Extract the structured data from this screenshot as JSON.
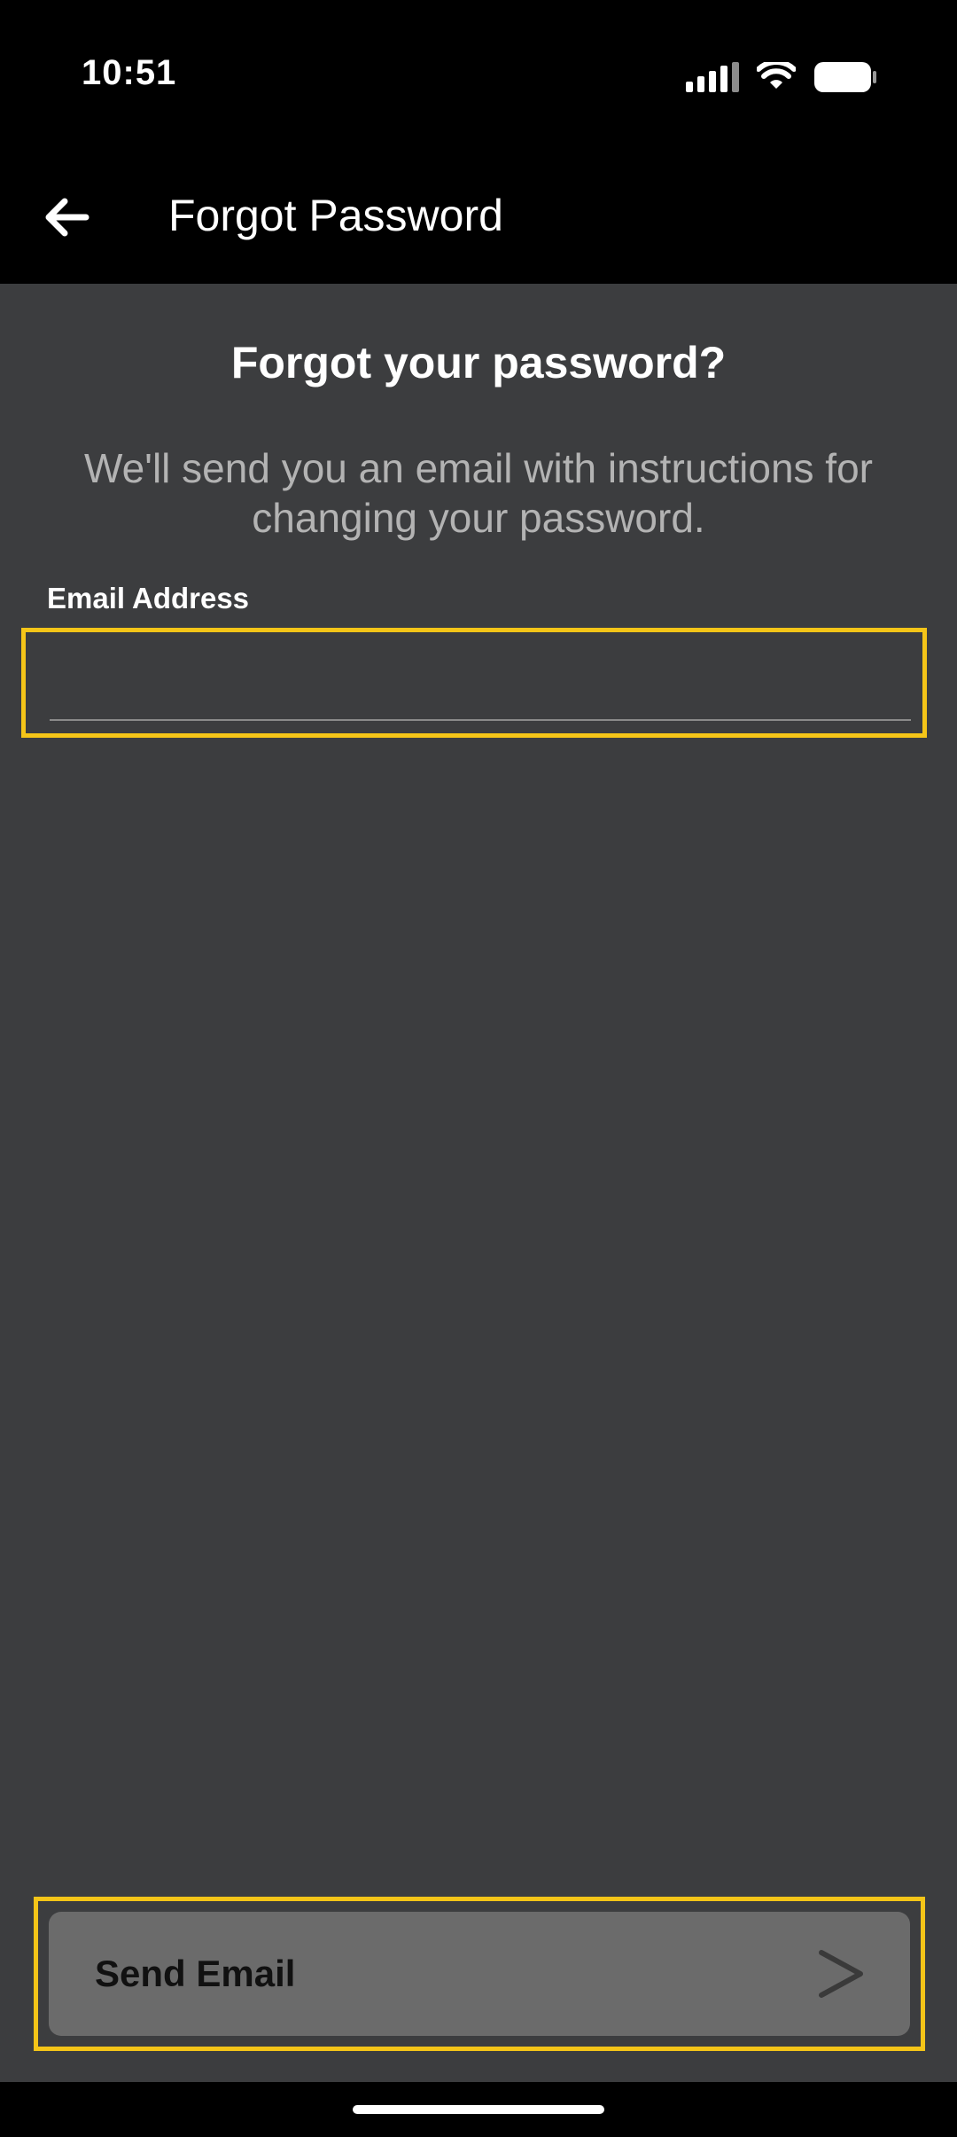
{
  "status_bar": {
    "time": "10:51",
    "icons": [
      "signal-icon",
      "wifi-icon",
      "battery-icon"
    ]
  },
  "app_bar": {
    "back_icon": "arrow-left-icon",
    "title": "Forgot Password"
  },
  "main": {
    "heading": "Forgot your password?",
    "description": "We'll send you an email with instructions for changing your password.",
    "email_field": {
      "label": "Email Address",
      "value": "",
      "placeholder": ""
    },
    "send_button": {
      "label": "Send Email",
      "icon": "chevron-right-icon"
    }
  },
  "colors": {
    "background": "#3c3d3f",
    "bar_background": "#000000",
    "highlight": "#f5c518",
    "button": "#6b6b6b",
    "description_text": "#b3b3b3"
  }
}
